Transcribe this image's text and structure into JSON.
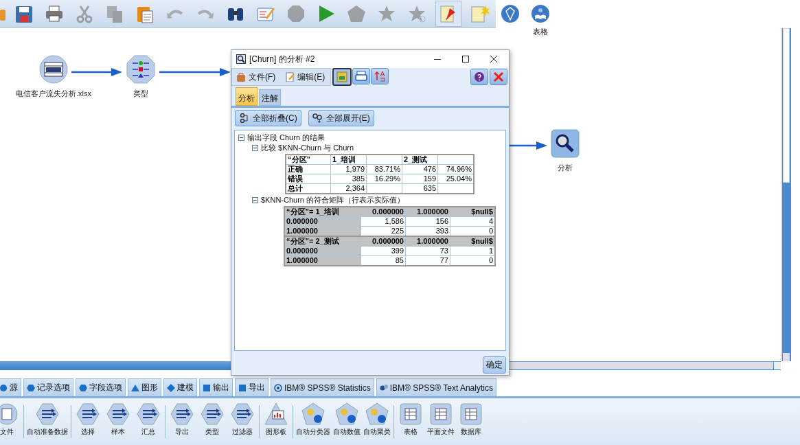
{
  "toolbar": [
    {
      "kind": "open",
      "disabled": false,
      "pressed": false
    },
    {
      "kind": "save",
      "disabled": false,
      "pressed": false
    },
    {
      "kind": "print",
      "disabled": false,
      "pressed": false
    },
    {
      "kind": "cut",
      "disabled": true,
      "pressed": false
    },
    {
      "kind": "copy",
      "disabled": true,
      "pressed": false
    },
    {
      "kind": "paste",
      "disabled": false,
      "pressed": false
    },
    {
      "kind": "undo",
      "disabled": true,
      "pressed": false
    },
    {
      "kind": "redo",
      "disabled": true,
      "pressed": false
    },
    {
      "kind": "find",
      "disabled": false,
      "pressed": false
    },
    {
      "kind": "edit",
      "disabled": false,
      "pressed": false
    },
    {
      "kind": "stop",
      "disabled": true,
      "pressed": false
    },
    {
      "kind": "run",
      "disabled": false,
      "pressed": false
    },
    {
      "kind": "runselection",
      "disabled": true,
      "pressed": false
    },
    {
      "kind": "star",
      "disabled": true,
      "pressed": false
    },
    {
      "kind": "starplus",
      "disabled": true,
      "pressed": false
    },
    {
      "kind": "pin",
      "disabled": false,
      "pressed": true
    },
    {
      "kind": "note",
      "disabled": false,
      "pressed": false
    },
    {
      "kind": "gem",
      "disabled": false,
      "pressed": false
    },
    {
      "kind": "abc",
      "disabled": false,
      "pressed": false,
      "label": "表格"
    }
  ],
  "canvas": {
    "nodes": [
      {
        "kind": "excel",
        "label": "电信客户流失分析.xlsx"
      },
      {
        "kind": "type",
        "label": "类型"
      },
      {
        "kind": "analysis",
        "label": "分析"
      }
    ]
  },
  "dialog": {
    "title": "[Churn] 的分析 #2",
    "menus": [
      {
        "kind": "file",
        "label": "文件(F)"
      },
      {
        "kind": "edit",
        "label": "编辑(E)"
      }
    ],
    "tools": [
      {
        "kind": "export",
        "pressed": true
      },
      {
        "kind": "print",
        "pressed": false
      },
      {
        "kind": "sort",
        "pressed": false
      },
      {
        "kind": "help",
        "pressed": false
      },
      {
        "kind": "close",
        "pressed": false
      }
    ],
    "tabs": [
      {
        "label": "分析",
        "selected": true
      },
      {
        "label": "注解",
        "selected": false
      }
    ],
    "buttons": [
      {
        "kind": "collapse",
        "label": "全部折叠(C)"
      },
      {
        "kind": "expand",
        "label": "全部展开(E)"
      }
    ],
    "tree": [
      {
        "label": "输出字段 Churn 的结果",
        "expanded": true,
        "children": [
          {
            "label": "比较 $KNN-Churn 与 Churn",
            "expanded": true,
            "table": {
              "kind": "comparison",
              "rows": [
                [
                  "“分区”",
                  "1_培训",
                  null,
                  "2_测试",
                  null
                ],
                [
                  "正确",
                  "1,979",
                  "83.71%",
                  "476",
                  "74.96%"
                ],
                [
                  "错误",
                  "385",
                  "16.29%",
                  "159",
                  "25.04%"
                ],
                [
                  "总计",
                  "2,364",
                  null,
                  "635",
                  null
                ]
              ]
            }
          },
          {
            "label": "$KNN-Churn 的符合矩阵（行表示实际值）",
            "expanded": true,
            "table": {
              "kind": "matrix",
              "sections": [
                {
                  "header": [
                    "“分区”= 1_培训",
                    "0.000000",
                    "1.000000",
                    "$null$"
                  ],
                  "rows": [
                    [
                      "0.000000",
                      "1,586",
                      "156",
                      "4"
                    ],
                    [
                      "1.000000",
                      "225",
                      "393",
                      "0"
                    ]
                  ]
                },
                {
                  "header": [
                    "“分区”= 2_测试",
                    "0.000000",
                    "1.000000",
                    "$null$"
                  ],
                  "rows": [
                    [
                      "0.000000",
                      "399",
                      "73",
                      "1"
                    ],
                    [
                      "1.000000",
                      "85",
                      "77",
                      "0"
                    ]
                  ]
                }
              ]
            }
          }
        ]
      }
    ],
    "ok_button": "确定"
  },
  "palette_tabs": [
    {
      "kind": "circle",
      "label": "源"
    },
    {
      "kind": "hexagon",
      "label": "记录选项"
    },
    {
      "kind": "hexagon",
      "label": "字段选项"
    },
    {
      "kind": "triangle",
      "label": "图形"
    },
    {
      "kind": "diamond",
      "label": "建模"
    },
    {
      "kind": "square",
      "label": "输出"
    },
    {
      "kind": "square",
      "label": "导出"
    },
    {
      "kind": "stats",
      "label": "IBM® SPSS® Statistics"
    },
    {
      "kind": "text",
      "label": "IBM® SPSS® Text Analytics"
    }
  ],
  "palette": [
    [
      {
        "kind": "circle",
        "label": "文件"
      }
    ],
    [
      {
        "kind": "hexagon",
        "label": "自动准备数据"
      }
    ],
    [
      {
        "kind": "hexagon",
        "label": "选择"
      },
      {
        "kind": "hexagon",
        "label": "样本"
      },
      {
        "kind": "hexagon",
        "label": "汇总"
      }
    ],
    [
      {
        "kind": "hexagon",
        "label": "导出"
      },
      {
        "kind": "hexagon",
        "label": "类型"
      },
      {
        "kind": "hexagon",
        "label": "过滤器"
      }
    ],
    [
      {
        "kind": "triangle",
        "label": "图形板"
      }
    ],
    [
      {
        "kind": "pentagon",
        "label": "自动分类器"
      },
      {
        "kind": "pentagon",
        "label": "自动数值"
      },
      {
        "kind": "pentagon",
        "label": "自动聚类"
      }
    ],
    [
      {
        "kind": "square",
        "label": "表格"
      },
      {
        "kind": "square",
        "label": "平面文件"
      },
      {
        "kind": "square",
        "label": "数据库"
      }
    ]
  ]
}
